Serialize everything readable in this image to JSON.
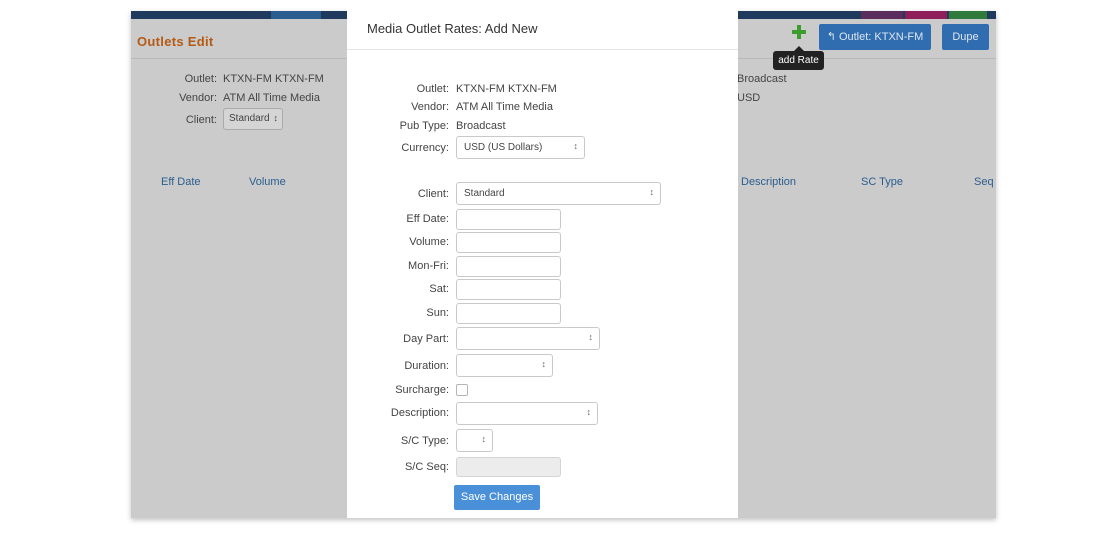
{
  "background": {
    "page_title": "Outlets Edit",
    "outlet_label": "Outlet:",
    "outlet_value": "KTXN-FM  KTXN-FM",
    "vendor_label": "Vendor:",
    "vendor_value": "ATM  All Time Media",
    "client_label": "Client:",
    "client_value": "Standard",
    "pub_type_value": "Broadcast",
    "currency_value": "USD",
    "columns": [
      "Eff Date",
      "Volume",
      "Description",
      "SC Type",
      "Seq"
    ],
    "add_rate_tooltip": "add Rate",
    "outlet_button": "Outlet: KTXN-FM",
    "dupe_button": "Dupe"
  },
  "modal": {
    "title": "Media Outlet Rates: Add New",
    "outlet_label": "Outlet:",
    "outlet_value": "KTXN-FM  KTXN-FM",
    "vendor_label": "Vendor:",
    "vendor_value": "ATM  All Time Media",
    "pub_type_label": "Pub Type:",
    "pub_type_value": "Broadcast",
    "currency_label": "Currency:",
    "currency_value": "USD (US Dollars)",
    "client_label": "Client:",
    "client_value": "Standard",
    "eff_date_label": "Eff Date:",
    "volume_label": "Volume:",
    "mon_fri_label": "Mon-Fri:",
    "sat_label": "Sat:",
    "sun_label": "Sun:",
    "day_part_label": "Day Part:",
    "duration_label": "Duration:",
    "surcharge_label": "Surcharge:",
    "description_label": "Description:",
    "sc_type_label": "S/C Type:",
    "sc_seq_label": "S/C Seq:",
    "save_button": "Save Changes"
  },
  "icons": {
    "select_arrow": "↕",
    "undo": "↰",
    "plus": "plus-icon"
  },
  "colors": {
    "accent_blue": "#4a90d9",
    "add_green": "#3e9c2f",
    "title_orange": "#b55a14"
  }
}
